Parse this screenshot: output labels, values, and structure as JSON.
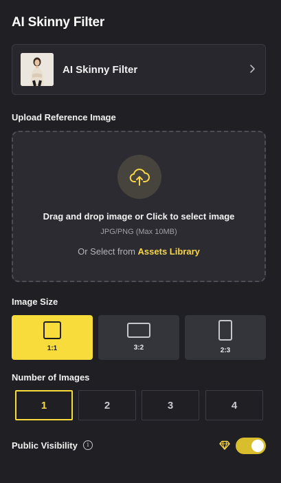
{
  "page": {
    "title": "AI Skinny Filter"
  },
  "model": {
    "name": "AI Skinny Filter",
    "thumbnail_icon": "woman-portrait-image"
  },
  "upload": {
    "label": "Upload Reference Image",
    "main_text": "Drag and drop image or Click to select image",
    "sub_text": "JPG/PNG (Max 10MB)",
    "alt_prefix": "Or Select from ",
    "alt_link": "Assets Library",
    "icon": "cloud-upload-icon"
  },
  "image_size": {
    "label": "Image Size",
    "options": [
      {
        "label": "1:1",
        "selected": true
      },
      {
        "label": "3:2",
        "selected": false
      },
      {
        "label": "2:3",
        "selected": false
      }
    ]
  },
  "num_images": {
    "label": "Number of Images",
    "options": [
      "1",
      "2",
      "3",
      "4"
    ],
    "selected": "1"
  },
  "visibility": {
    "label": "Public Visibility",
    "info_icon": "i",
    "enabled": true,
    "premium_icon": "diamond-icon"
  },
  "colors": {
    "background": "#1f1f24",
    "accent": "#f7dc3b",
    "card": "#27272d",
    "button": "#34343b"
  }
}
